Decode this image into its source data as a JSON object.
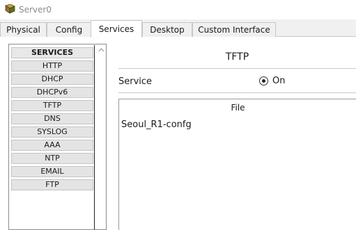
{
  "window": {
    "title": "Server0",
    "icon": "server-icon"
  },
  "tabs": [
    {
      "label": "Physical"
    },
    {
      "label": "Config"
    },
    {
      "label": "Services"
    },
    {
      "label": "Desktop"
    },
    {
      "label": "Custom Interface"
    }
  ],
  "active_tab": "Services",
  "services": {
    "header": "SERVICES",
    "items": [
      "HTTP",
      "DHCP",
      "DHCPv6",
      "TFTP",
      "DNS",
      "SYSLOG",
      "AAA",
      "NTP",
      "EMAIL",
      "FTP"
    ]
  },
  "panel": {
    "title": "TFTP",
    "service_label": "Service",
    "on_label": "On",
    "file_header": "File",
    "files": [
      "Seoul_R1-confg"
    ]
  }
}
